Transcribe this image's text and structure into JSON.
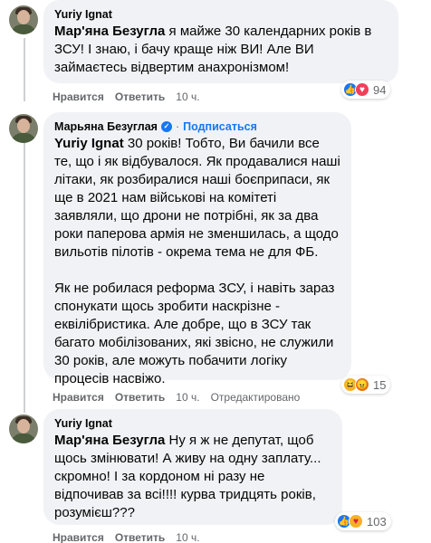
{
  "comments": [
    {
      "author": "Yuriy Ignat",
      "mention": "Мар'яна Безугла",
      "text": " я майже 30 календарних років в ЗСУ! І знаю, і бачу краще ніж ВИ! Але ВИ займаєтесь відвертим анахронізмом!",
      "like_label": "Нравится",
      "reply_label": "Ответить",
      "time": "10 ч.",
      "reactions": [
        "like",
        "love"
      ],
      "reaction_count": "94"
    },
    {
      "author": "Марьяна Безуглая",
      "verified": true,
      "subscribe_label": "Подписаться",
      "dot": "·",
      "mention": "Yuriy Ignat",
      "text_p1": " 30 років! Тобто, Ви бачили все те, що і як відбувалося. Як продавалися наші літаки, як розбиралися наші боєприпаси, як ще в 2021 нам військові на комітеті заявляли, що дрони не потрібні, як за два роки паперова армія не зменшилась, а щодо вильотів пілотів - окрема тема не для ФБ.",
      "text_p2": "Як не робилася реформа ЗСУ, і навіть зараз спонукати щось зробити наскрізне - еквілібристика. Але добре, що в ЗСУ так багато мобілізованих, які звісно, не служили 30 років, але можуть побачити логіку процесів насвіжо.",
      "like_label": "Нравится",
      "reply_label": "Ответить",
      "time": "10 ч.",
      "edited_label": "Отредактировано",
      "reactions": [
        "haha",
        "angry"
      ],
      "reaction_count": "15"
    },
    {
      "author": "Yuriy Ignat",
      "mention": "Мар'яна Безугла",
      "text": " Ну я ж не депутат, щоб щось змінювати! А живу на одну заплату... скромно! І за кордоном ні разу не відпочивав за всі!!!! курва тридцять років, розумієш???",
      "like_label": "Нравится",
      "reply_label": "Ответить",
      "time": "10 ч.",
      "reactions": [
        "like",
        "care"
      ],
      "reaction_count": "103"
    }
  ],
  "colors": {
    "bubble": "#f0f2f5",
    "link": "#1877f2",
    "muted": "#65676b",
    "text": "#050505"
  }
}
